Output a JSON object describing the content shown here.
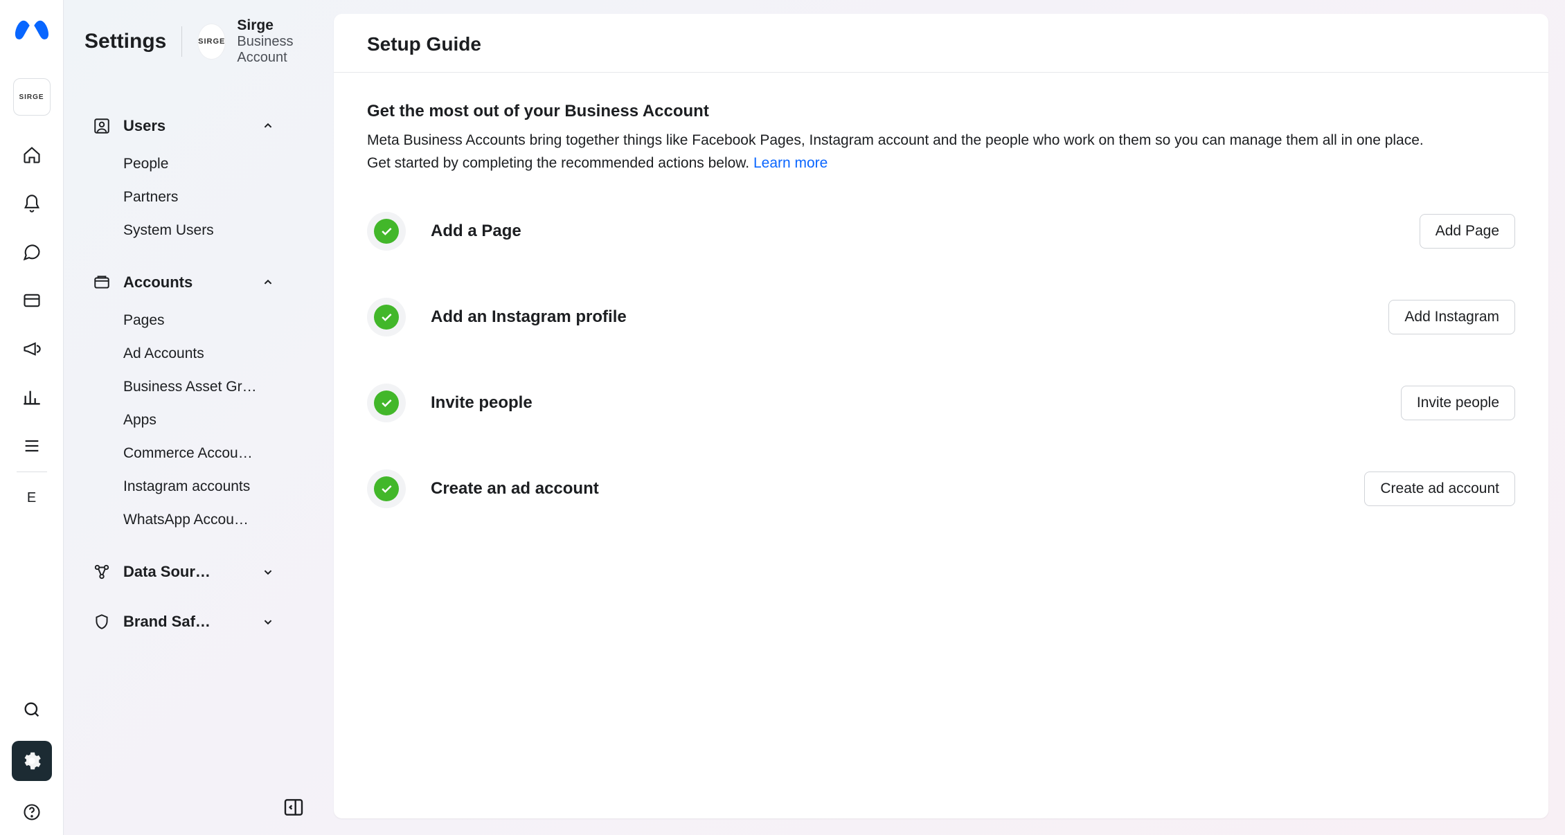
{
  "rail": {
    "avatar_text": "SIRGE",
    "user_letter": "E"
  },
  "sidebar": {
    "title": "Settings",
    "business": {
      "logo_text": "SIRGE",
      "name": "Sirge",
      "subtitle": "Business Account"
    },
    "sections": [
      {
        "label": "Users",
        "expanded": true,
        "items": [
          "People",
          "Partners",
          "System Users"
        ]
      },
      {
        "label": "Accounts",
        "expanded": true,
        "items": [
          "Pages",
          "Ad Accounts",
          "Business Asset Gr…",
          "Apps",
          "Commerce Accou…",
          "Instagram accounts",
          "WhatsApp Accou…"
        ]
      },
      {
        "label": "Data Sour…",
        "expanded": false,
        "items": []
      },
      {
        "label": "Brand Saf…",
        "expanded": false,
        "items": []
      }
    ]
  },
  "main": {
    "header_title": "Setup Guide",
    "intro_title": "Get the most out of your Business Account",
    "intro_text": "Meta Business Accounts bring together things like Facebook Pages, Instagram account and the people who work on them so you can manage them all in one place. Get started by completing the recommended actions below. ",
    "learn_more": "Learn more",
    "steps": [
      {
        "label": "Add a Page",
        "button": "Add Page",
        "done": true
      },
      {
        "label": "Add an Instagram profile",
        "button": "Add Instagram",
        "done": true
      },
      {
        "label": "Invite people",
        "button": "Invite people",
        "done": true
      },
      {
        "label": "Create an ad account",
        "button": "Create ad account",
        "done": true
      }
    ]
  }
}
